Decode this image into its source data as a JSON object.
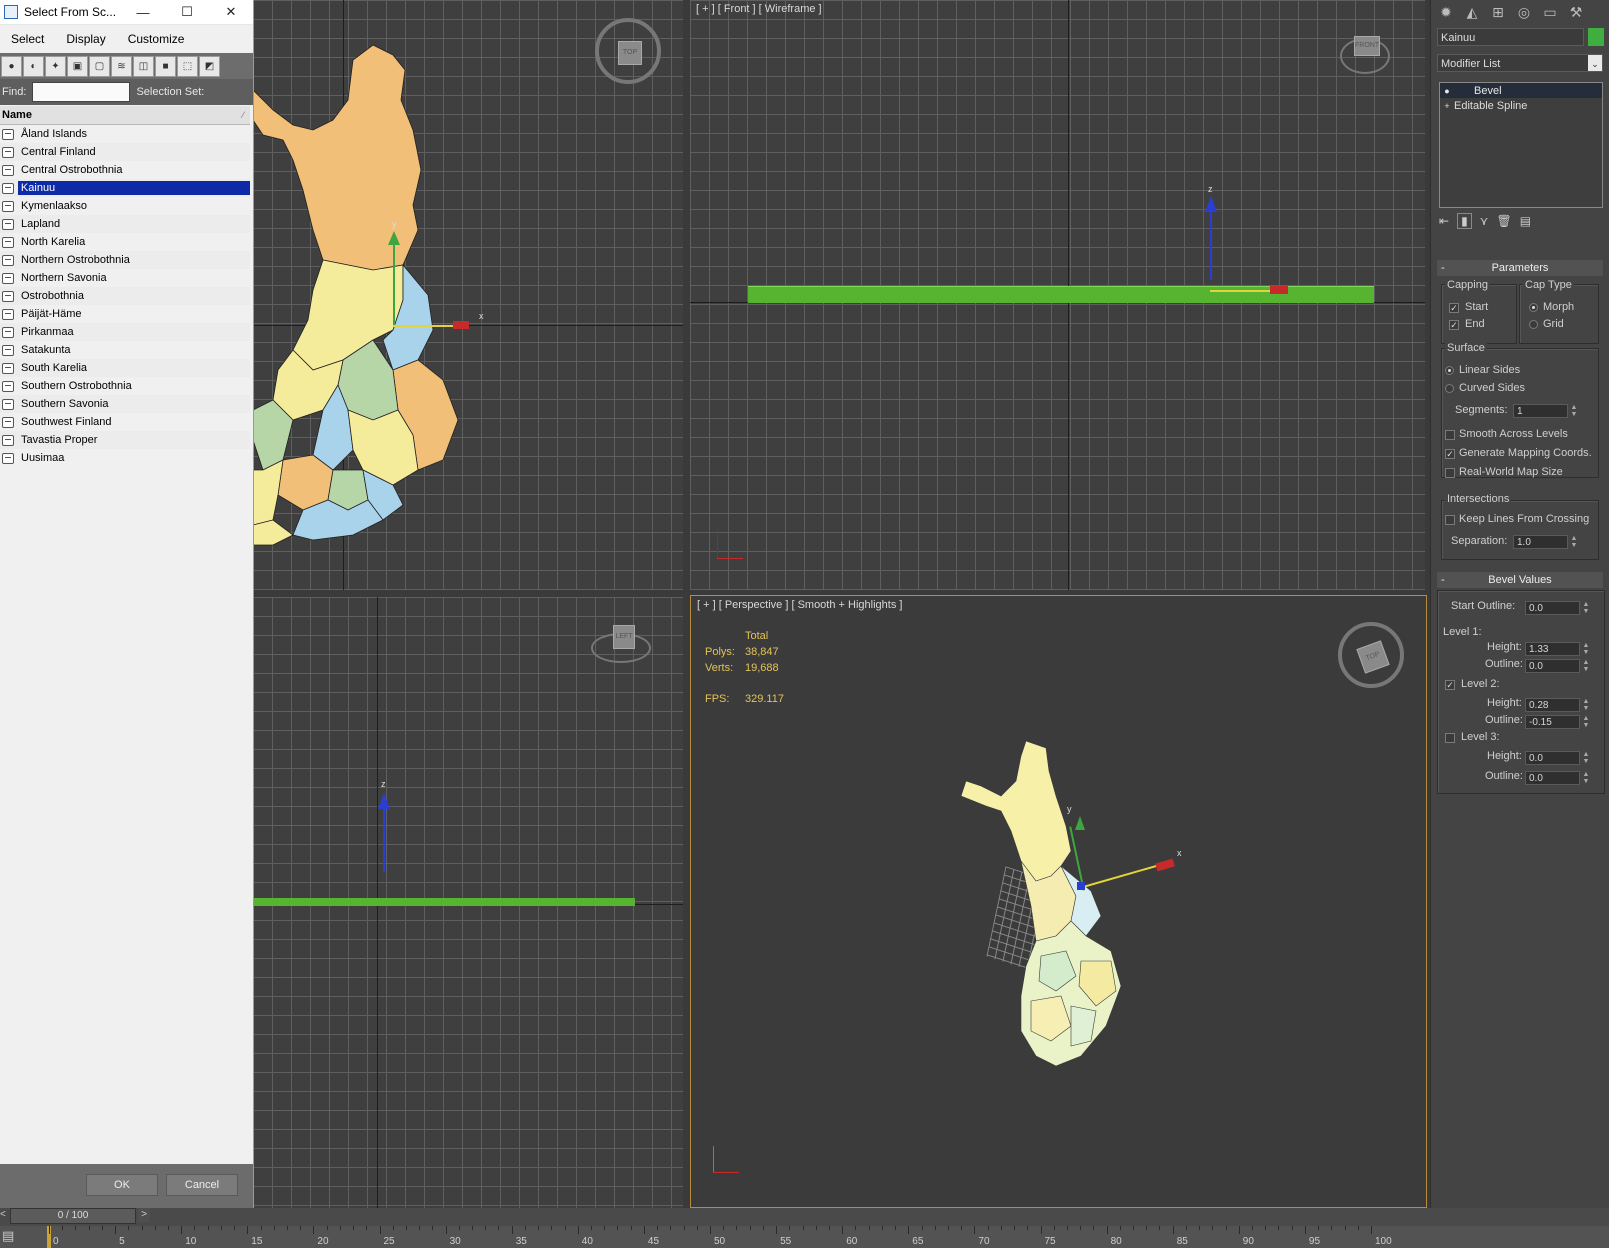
{
  "dialog": {
    "title": "Select From Sc...",
    "window_buttons": {
      "minimize": "—",
      "maximize": "☐",
      "close": "✕"
    },
    "menu": [
      "Select",
      "Display",
      "Customize"
    ],
    "find_label": "Find:",
    "find_value": "",
    "selection_set_label": "Selection Set:",
    "column_header": "Name",
    "items": [
      {
        "label": "Åland Islands",
        "selected": false
      },
      {
        "label": "Central Finland",
        "selected": false
      },
      {
        "label": "Central Ostrobothnia",
        "selected": false
      },
      {
        "label": "Kainuu",
        "selected": true
      },
      {
        "label": "Kymenlaakso",
        "selected": false
      },
      {
        "label": "Lapland",
        "selected": false
      },
      {
        "label": "North Karelia",
        "selected": false
      },
      {
        "label": "Northern Ostrobothnia",
        "selected": false
      },
      {
        "label": "Northern Savonia",
        "selected": false
      },
      {
        "label": "Ostrobothnia",
        "selected": false
      },
      {
        "label": "Päijät-Häme",
        "selected": false
      },
      {
        "label": "Pirkanmaa",
        "selected": false
      },
      {
        "label": "Satakunta",
        "selected": false
      },
      {
        "label": "South Karelia",
        "selected": false
      },
      {
        "label": "Southern Ostrobothnia",
        "selected": false
      },
      {
        "label": "Southern Savonia",
        "selected": false
      },
      {
        "label": "Southwest Finland",
        "selected": false
      },
      {
        "label": "Tavastia Proper",
        "selected": false
      },
      {
        "label": "Uusimaa",
        "selected": false
      }
    ],
    "ok_label": "OK",
    "cancel_label": "Cancel"
  },
  "viewports": {
    "front_label": "[ + ] [ Front ] [ Wireframe ]",
    "perspective_label": "[ + ] [ Perspective ] [ Smooth + Highlights ]",
    "cube_top": "TOP",
    "cube_front": "FRONT",
    "cube_left": "LEFT",
    "stats": {
      "total_label": "Total",
      "polys_label": "Polys:",
      "polys_value": "38,847",
      "verts_label": "Verts:",
      "verts_value": "19,688",
      "fps_label": "FPS:",
      "fps_value": "329.117"
    },
    "axis": {
      "x": "x",
      "y": "y",
      "z": "z"
    }
  },
  "command_panel": {
    "object_name": "Kainuu",
    "object_color": "#3fae3f",
    "modifier_list": "Modifier List",
    "stack": [
      "Bevel",
      "Editable Spline"
    ],
    "parameters": {
      "title": "Parameters",
      "capping_label": "Capping",
      "start_label": "Start",
      "start_checked": true,
      "end_label": "End",
      "end_checked": true,
      "cap_type_label": "Cap Type",
      "morph_label": "Morph",
      "grid_label": "Grid",
      "surface_label": "Surface",
      "linear_sides_label": "Linear Sides",
      "curved_sides_label": "Curved Sides",
      "segments_label": "Segments:",
      "segments_value": "1",
      "smooth_across_label": "Smooth Across Levels",
      "gen_mapping_label": "Generate Mapping Coords.",
      "real_world_label": "Real-World Map Size",
      "intersections_label": "Intersections",
      "keep_lines_label": "Keep Lines From Crossing",
      "separation_label": "Separation:",
      "separation_value": "1.0"
    },
    "bevel_values": {
      "title": "Bevel Values",
      "start_outline_label": "Start Outline:",
      "start_outline_value": "0.0",
      "level1_label": "Level 1:",
      "height_label": "Height:",
      "outline_label": "Outline:",
      "l1_height": "1.33",
      "l1_outline": "0.0",
      "level2_label": "Level 2:",
      "l2_height": "0.28",
      "l2_outline": "-0.15",
      "level3_label": "Level 3:",
      "l3_height": "0.0",
      "l3_outline": "0.0"
    }
  },
  "timeline": {
    "slider_label": "0 / 100",
    "ticks": [
      "0",
      "5",
      "10",
      "15",
      "20",
      "25",
      "30",
      "35",
      "40",
      "45",
      "50",
      "55",
      "60",
      "65",
      "70",
      "75",
      "80",
      "85",
      "90",
      "95",
      "100"
    ]
  },
  "colors": {
    "map_orange": "#f1bf78",
    "map_yellow": "#f4ec9a",
    "map_blue": "#a9d3ea",
    "map_green": "#b6d6a8",
    "selection_green": "#56b431",
    "list_selected": "#0f2aa6"
  }
}
